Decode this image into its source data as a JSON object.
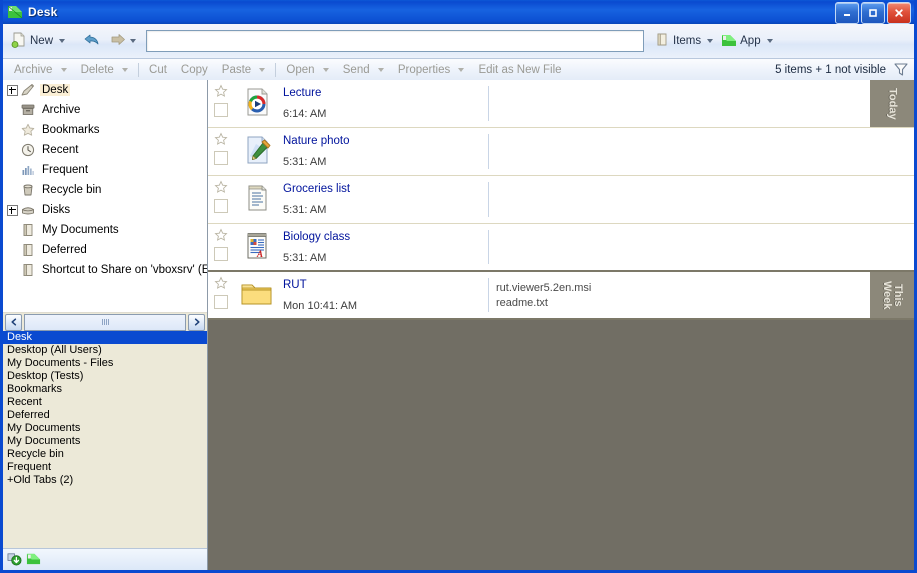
{
  "window": {
    "title": "Desk",
    "icon": "app-folder-icon",
    "buttons": {
      "minimize": "Minimize",
      "maximize": "Maximize",
      "close": "Close"
    }
  },
  "toolbar": {
    "new_label": "New",
    "back_icon": "back-arrow-icon",
    "forward_icon": "forward-arrow-icon",
    "search_value": "",
    "search_placeholder": "",
    "items_label": "Items",
    "app_label": "App"
  },
  "commandbar": {
    "items": [
      {
        "label": "Archive",
        "has_caret": true
      },
      {
        "label": "Delete",
        "has_caret": true
      },
      {
        "label": "Cut",
        "has_caret": false
      },
      {
        "label": "Copy",
        "has_caret": false
      },
      {
        "label": "Paste",
        "has_caret": true
      },
      {
        "label": "Open",
        "has_caret": true
      },
      {
        "label": "Send",
        "has_caret": true
      },
      {
        "label": "Properties",
        "has_caret": true
      },
      {
        "label": "Edit as New File",
        "has_caret": false
      }
    ],
    "status_count": "5 items + 1 not visible",
    "filter_icon": "funnel-filter-icon"
  },
  "tree": {
    "items": [
      {
        "label": "Desk",
        "icon": "pen-icon",
        "expandable": true,
        "selected": true
      },
      {
        "label": "Archive",
        "icon": "archive-box-icon",
        "expandable": false,
        "selected": false
      },
      {
        "label": "Bookmarks",
        "icon": "star-icon",
        "expandable": false,
        "selected": false
      },
      {
        "label": "Recent",
        "icon": "clock-icon",
        "expandable": false,
        "selected": false
      },
      {
        "label": "Frequent",
        "icon": "bar-chart-icon",
        "expandable": false,
        "selected": false
      },
      {
        "label": "Recycle bin",
        "icon": "trash-icon",
        "expandable": false,
        "selected": false
      },
      {
        "label": "Disks",
        "icon": "disk-icon",
        "expandable": true,
        "selected": false
      },
      {
        "label": "My Documents",
        "icon": "documents-icon",
        "expandable": false,
        "selected": false
      },
      {
        "label": "Deferred",
        "icon": "documents-icon",
        "expandable": false,
        "selected": false
      },
      {
        "label": "Shortcut to Share on 'vboxsrv' (E:",
        "icon": "documents-icon",
        "expandable": false,
        "selected": false
      }
    ]
  },
  "tabs": {
    "scroll_left_icon": "chevron-left-icon",
    "scroll_right_icon": "chevron-right-icon",
    "items": [
      {
        "label": "Desk",
        "selected": true
      },
      {
        "label": "Desktop  (All Users)",
        "selected": false
      },
      {
        "label": "My Documents - Files",
        "selected": false
      },
      {
        "label": "Desktop  (Tests)",
        "selected": false
      },
      {
        "label": "Bookmarks",
        "selected": false
      },
      {
        "label": "Recent",
        "selected": false
      },
      {
        "label": "Deferred",
        "selected": false
      },
      {
        "label": "My Documents",
        "selected": false
      },
      {
        "label": "My Documents",
        "selected": false
      },
      {
        "label": "Recycle bin",
        "selected": false
      },
      {
        "label": "Frequent",
        "selected": false
      },
      {
        "label": "+Old Tabs (2)",
        "selected": false
      }
    ],
    "status_icons": [
      "download-icon",
      "app-folder-icon"
    ]
  },
  "files": {
    "rows": [
      {
        "name": "Lecture",
        "time": "6:14: AM",
        "icon": "media-player-file-icon",
        "extra": [],
        "group": "Today",
        "group_start": true,
        "group_end": false
      },
      {
        "name": "Nature photo",
        "time": "5:31: AM",
        "icon": "paint-file-icon",
        "extra": [],
        "group": "",
        "group_start": false,
        "group_end": false
      },
      {
        "name": "Groceries list",
        "time": "5:31: AM",
        "icon": "notepad-file-icon",
        "extra": [],
        "group": "",
        "group_start": false,
        "group_end": false
      },
      {
        "name": "Biology class",
        "time": "5:31: AM",
        "icon": "wordpad-file-icon",
        "extra": [],
        "group": "",
        "group_start": false,
        "group_end": true
      },
      {
        "name": "RUT",
        "time": "Mon 10:41: AM",
        "icon": "folder-icon",
        "extra": [
          "rut.viewer5.2en.msi",
          "readme.txt"
        ],
        "group": "This\nWeek",
        "group_start": true,
        "group_end": true
      }
    ]
  },
  "colors": {
    "titlebar": "#0a4ad0",
    "link": "#00139c",
    "empty_area": "#716e64",
    "group_band": "#8c887a",
    "selection": "#0a4ad0"
  }
}
